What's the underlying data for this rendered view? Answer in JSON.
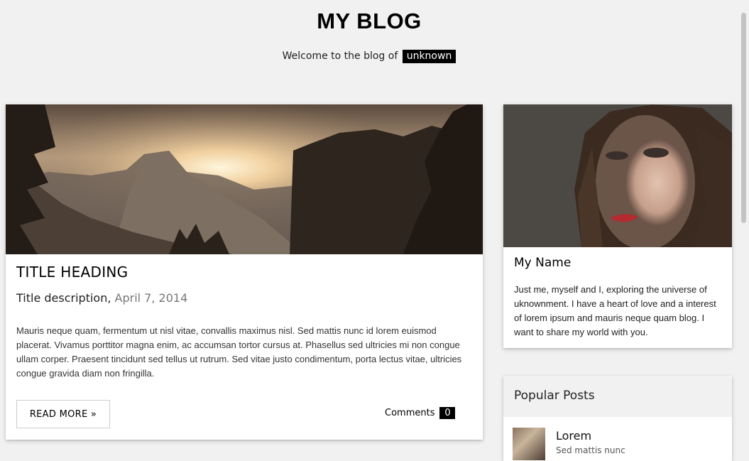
{
  "header": {
    "title": "MY BLOG",
    "welcome_text": "Welcome to the blog of",
    "author_tag": "unknown"
  },
  "post": {
    "image_icon": "landscape-photo",
    "title": "TITLE HEADING",
    "description": "Title description,",
    "date": "April 7, 2014",
    "body": "Mauris neque quam, fermentum ut nisl vitae, convallis maximus nisl. Sed mattis nunc id lorem euismod placerat. Vivamus porttitor magna enim, ac accumsan tortor cursus at. Phasellus sed ultricies mi non congue ullam corper. Praesent tincidunt sed tellus ut rutrum. Sed vitae justo condimentum, porta lectus vitae, ultricies congue gravida diam non fringilla.",
    "read_more_label": "READ MORE »",
    "comments_label": "Comments",
    "comments_count": "0"
  },
  "profile": {
    "photo_icon": "portrait-photo",
    "name": "My Name",
    "bio": "Just me, myself and I, exploring the universe of uknownment. I have a heart of love and a interest of lorem ipsum and mauris neque quam blog. I want to share my world with you."
  },
  "popular_posts": {
    "heading": "Popular Posts",
    "items": [
      {
        "title": "Lorem",
        "subtitle": "Sed mattis nunc"
      }
    ]
  },
  "colors": {
    "page_background": "#f1f1f1",
    "card_background": "#ffffff",
    "badge_background": "#000000",
    "badge_text": "#ffffff"
  }
}
